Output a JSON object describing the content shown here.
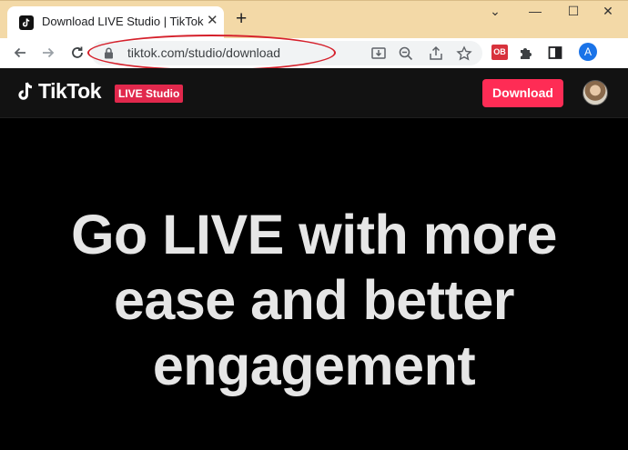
{
  "browser": {
    "tab_title": "Download LIVE Studio | TikTok",
    "tab_close": "✕",
    "new_tab": "+",
    "window_controls": [
      "⌄",
      "—",
      "☐",
      "✕"
    ],
    "url": "tiktok.com/studio/download",
    "extension_badge": "OB",
    "profile_initial": "A",
    "annotation_color": "#d5202b"
  },
  "site": {
    "brand": "TikTok",
    "badge": "LIVE Studio",
    "download_label": "Download",
    "accent": "#fe2c55"
  },
  "hero": {
    "lines": [
      "Go LIVE with more",
      "ease and better",
      "engagement"
    ]
  }
}
